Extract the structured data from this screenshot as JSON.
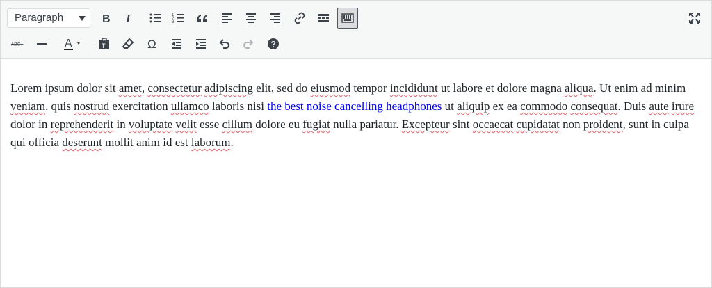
{
  "toolbar": {
    "format_select_value": "Paragraph",
    "icons": {
      "bold": "bold-icon",
      "italic": "italic-icon",
      "bullet_list": "bullet-list-icon",
      "numbered_list": "numbered-list-icon",
      "blockquote": "blockquote-icon",
      "align_left": "align-left-icon",
      "align_center": "align-center-icon",
      "align_right": "align-right-icon",
      "link": "link-icon",
      "read_more": "read-more-icon",
      "toolbar_toggle": "toolbar-toggle-icon",
      "fullscreen": "fullscreen-icon",
      "strikethrough": "strikethrough-icon",
      "horizontal_line": "horizontal-line-icon",
      "text_color": "text-color-icon",
      "paste_text": "paste-text-icon",
      "clear_formatting": "clear-formatting-icon",
      "special_character": "omega-icon",
      "outdent": "outdent-icon",
      "indent": "indent-icon",
      "undo": "undo-icon",
      "redo": "redo-icon",
      "help": "help-icon"
    },
    "strikethrough_label": "ABC",
    "text_color_letter": "A",
    "text_color_swatch": "#1d2327",
    "omega_glyph": "Ω",
    "help_glyph": "?"
  },
  "content": {
    "segments": [
      {
        "text": "Lorem ipsum dolor sit "
      },
      {
        "text": "amet",
        "spell": true
      },
      {
        "text": ", "
      },
      {
        "text": "consectetur",
        "spell": true
      },
      {
        "text": " "
      },
      {
        "text": "adipiscing",
        "spell": true
      },
      {
        "text": " elit, sed do "
      },
      {
        "text": "eiusmod",
        "spell": true
      },
      {
        "text": " tempor "
      },
      {
        "text": "incididunt",
        "spell": true
      },
      {
        "text": " ut labore et dolore magna "
      },
      {
        "text": "aliqua",
        "spell": true
      },
      {
        "text": ". Ut enim ad minim "
      },
      {
        "text": "veniam",
        "spell": true
      },
      {
        "text": ", quis "
      },
      {
        "text": "nostrud",
        "spell": true
      },
      {
        "text": " exercitation "
      },
      {
        "text": "ullamco",
        "spell": true
      },
      {
        "text": " laboris nisi "
      },
      {
        "text": "the best noise cancelling headphones",
        "link": true
      },
      {
        "text": " ut "
      },
      {
        "text": "aliquip",
        "spell": true
      },
      {
        "text": " ex ea "
      },
      {
        "text": "commodo",
        "spell": true
      },
      {
        "text": " "
      },
      {
        "text": "consequat",
        "spell": true
      },
      {
        "text": ". Duis "
      },
      {
        "text": "aute",
        "spell": true
      },
      {
        "text": " "
      },
      {
        "text": "irure",
        "spell": true
      },
      {
        "text": " dolor in "
      },
      {
        "text": "reprehenderit",
        "spell": true
      },
      {
        "text": " in "
      },
      {
        "text": "voluptate",
        "spell": true
      },
      {
        "text": " "
      },
      {
        "text": "velit",
        "spell": true
      },
      {
        "text": " esse "
      },
      {
        "text": "cillum",
        "spell": true
      },
      {
        "text": " dolore eu "
      },
      {
        "text": "fugiat",
        "spell": true
      },
      {
        "text": " nulla pariatur. "
      },
      {
        "text": "Excepteur",
        "spell": true
      },
      {
        "text": " sint "
      },
      {
        "text": "occaecat",
        "spell": true
      },
      {
        "text": " "
      },
      {
        "text": "cupidatat",
        "spell": true
      },
      {
        "text": " non "
      },
      {
        "text": "proident",
        "spell": true
      },
      {
        "text": ", sunt in culpa qui officia "
      },
      {
        "text": "deserunt",
        "spell": true
      },
      {
        "text": " mollit anim id est "
      },
      {
        "text": "laborum",
        "spell": true
      },
      {
        "text": "."
      }
    ]
  }
}
